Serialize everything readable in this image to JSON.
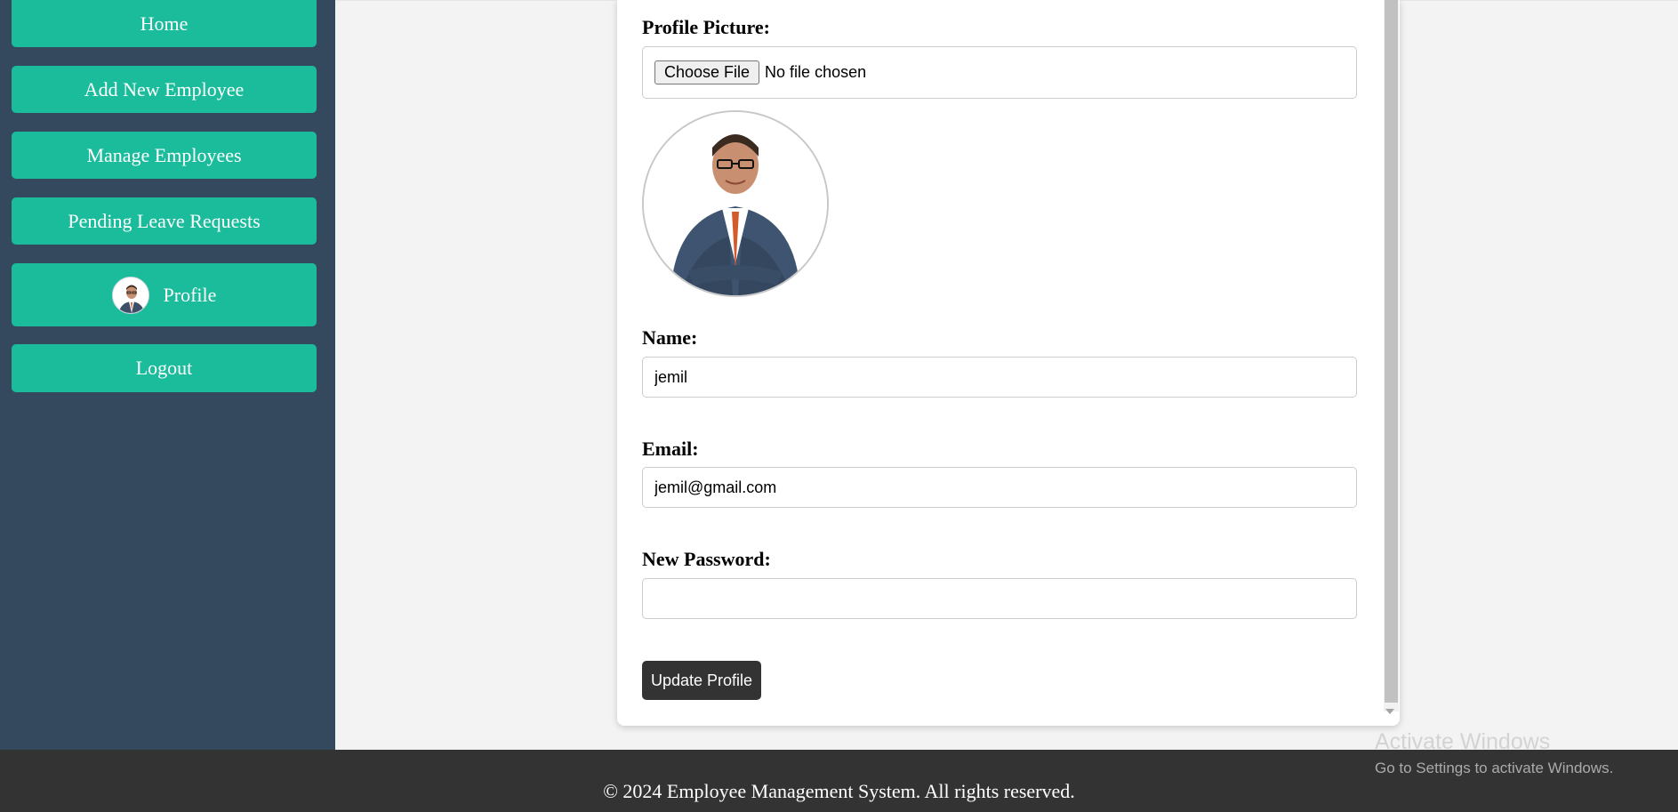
{
  "sidebar": {
    "items": [
      {
        "label": "Home"
      },
      {
        "label": "Add New Employee"
      },
      {
        "label": "Manage Employees"
      },
      {
        "label": "Pending Leave Requests"
      },
      {
        "label": "Profile",
        "icon": "avatar"
      },
      {
        "label": "Logout"
      }
    ]
  },
  "form": {
    "picture_label": "Profile Picture:",
    "choose_file_label": "Choose File",
    "no_file_text": "No file chosen",
    "name_label": "Name:",
    "name_value": "jemil",
    "email_label": "Email:",
    "email_value": "jemil@gmail.com",
    "password_label": "New Password:",
    "password_value": "",
    "submit_label": "Update Profile"
  },
  "footer": {
    "text": "© 2024 Employee Management System. All rights reserved."
  },
  "watermark": {
    "title": "Activate Windows",
    "subtitle": "Go to Settings to activate Windows."
  },
  "colors": {
    "sidebar_bg": "#34495e",
    "nav_button": "#1abc9c",
    "footer_bg": "#333333",
    "submit_bg": "#333333"
  }
}
